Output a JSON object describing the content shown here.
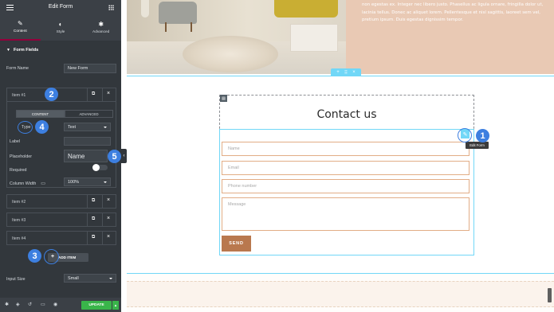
{
  "panel": {
    "title": "Edit Form",
    "tabs": [
      {
        "label": "Content",
        "icon": "pencil-icon"
      },
      {
        "label": "Style",
        "icon": "contrast-icon"
      },
      {
        "label": "Advanced",
        "icon": "gear-icon"
      }
    ],
    "section_title": "Form Fields",
    "form_name_label": "Form Name",
    "form_name_value": "New Form",
    "items": [
      {
        "label": "Item #1"
      },
      {
        "label": "Item #2"
      },
      {
        "label": "Item #3"
      },
      {
        "label": "Item #4"
      }
    ],
    "subtabs": [
      "CONTENT",
      "ADVANCED"
    ],
    "type_label": "Type",
    "type_value": "Text",
    "label_label": "Label",
    "label_value": "",
    "placeholder_label": "Placeholder",
    "placeholder_value": "Name",
    "required_label": "Required",
    "column_width_label": "Column Width",
    "column_width_value": "100%",
    "add_item_label": "ADD ITEM",
    "input_size_label": "Input Size",
    "input_size_value": "Small",
    "update_label": "UPDATE"
  },
  "callouts": [
    "1",
    "2",
    "3",
    "4",
    "5"
  ],
  "canvas": {
    "hero_text": "non egestas ex. Integer nec libero justo. Phasellus ac ligula ornare, fringilla dolor ut, lacinia tellus. Donec ac aliquet lorem. Pellentesque et nisl sagittis, laoreet sem vel, pretium ipsum. Duis egestas dignissim tempor.",
    "form_title": "Contact us",
    "fields": [
      {
        "placeholder": "Name"
      },
      {
        "placeholder": "Email"
      },
      {
        "placeholder": "Phone number"
      },
      {
        "placeholder": "Message"
      }
    ],
    "send_label": "SEND",
    "edit_tooltip": "Edit Form"
  },
  "colors": {
    "accent_blue": "#3d7fe0",
    "section_cyan": "#71d7f7",
    "field_border": "#e2ad86",
    "send_button": "#b9784e",
    "update_green": "#39b54a",
    "panel_bg": "#32373c"
  }
}
